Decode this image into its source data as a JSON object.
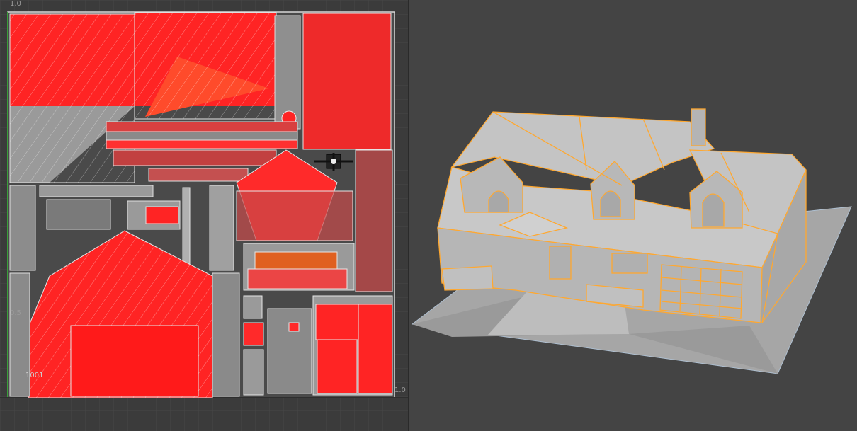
{
  "uv_editor": {
    "axis_top_label": "1.0",
    "axis_mid_label": "0.5",
    "axis_right_label": "1.0",
    "udim_label": "1001",
    "pivot_icon": "uv-manipulator-icon",
    "colors": {
      "background": "#3b3b3b",
      "grid": "#4a4a4a",
      "frame": "#d8d8d8",
      "shell_fill": "#ff1f1f",
      "shell_gray": "#8a8a8a",
      "wire": "#dddddd",
      "u_axis": "#3aa03a"
    }
  },
  "perspective_view": {
    "colors": {
      "background": "#444444",
      "model_fill": "#bcbcbc",
      "selection_wire": "#ffa830",
      "ground": "#a8a8a8"
    }
  }
}
